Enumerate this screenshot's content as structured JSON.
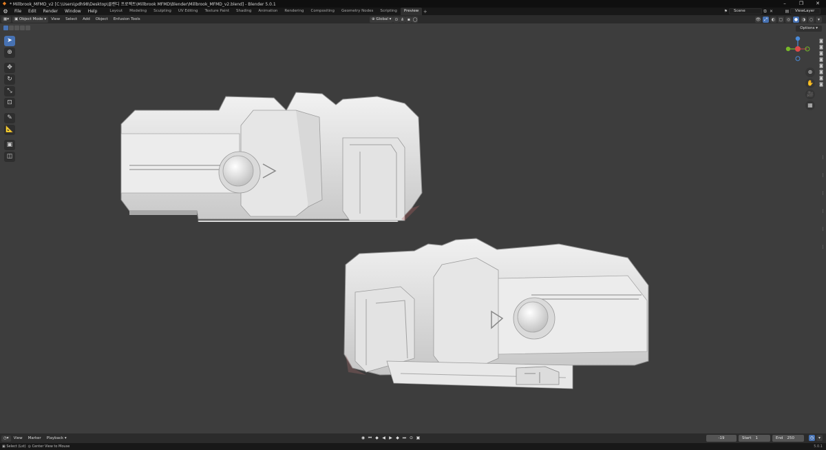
{
  "window": {
    "title": "* Millbrook_MFMD_v2 [C:\\Users\\pdh98\\Desktop\\클랜디 프로젝트\\Millbrook MFMD\\Blender\\Millbrook_MFMD_v2.blend] - Blender 5.0.1",
    "minimize_icon": "–",
    "maximize_icon": "❐",
    "close_icon": "✕"
  },
  "menubar": {
    "items": [
      "File",
      "Edit",
      "Render",
      "Window",
      "Help"
    ]
  },
  "workspaces": {
    "tabs": [
      "Layout",
      "Modeling",
      "Sculpting",
      "UV Editing",
      "Texture Paint",
      "Shading",
      "Animation",
      "Rendering",
      "Compositing",
      "Geometry Nodes",
      "Scripting",
      "Preview"
    ],
    "active": "Preview",
    "add_label": "+"
  },
  "scene": {
    "label": "Scene"
  },
  "view_layer": {
    "label": "ViewLayer"
  },
  "viewport_header": {
    "mode": "Object Mode",
    "menus": [
      "View",
      "Select",
      "Add",
      "Object",
      "Enfusion Tools"
    ],
    "transform_orientation": "Global",
    "options_label": "Options"
  },
  "gizmo": {
    "x_color": "#e04a4a",
    "y_color": "#78b828",
    "z_color": "#4a8ad8"
  },
  "timeline": {
    "menus": [
      "View",
      "Marker",
      "Playback"
    ],
    "current_frame": "-19",
    "start_label": "Start",
    "start_value": "1",
    "end_label": "End",
    "end_value": "250"
  },
  "statusbar": {
    "select": "Select (Lst)",
    "center": "Center View to Mouse",
    "version": "5.0.1"
  },
  "colors": {
    "viewport_bg": "#3d3d3d",
    "accent": "#4772b3",
    "model": "#e9e9e9"
  }
}
